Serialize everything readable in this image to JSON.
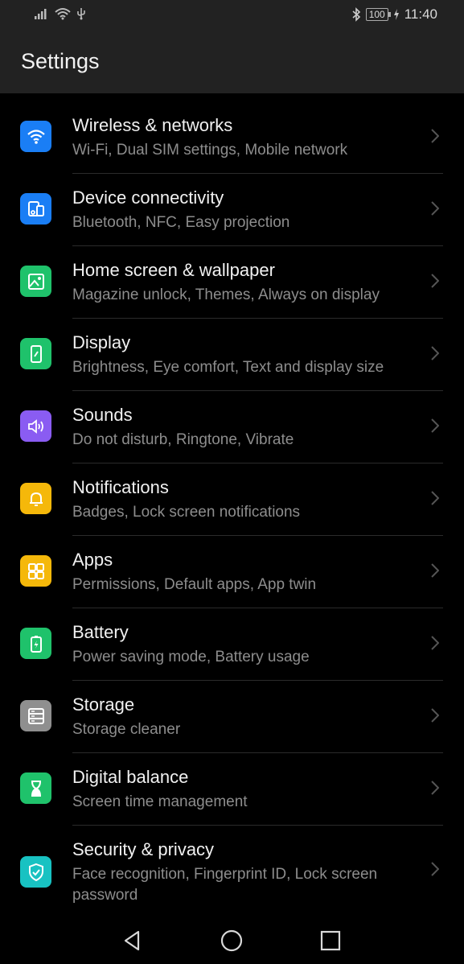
{
  "status": {
    "time": "11:40",
    "battery": "100",
    "icons": [
      "signal-icon",
      "wifi-icon",
      "usb-icon",
      "bluetooth-icon",
      "battery-icon",
      "charging-icon"
    ]
  },
  "header": {
    "title": "Settings"
  },
  "items": [
    {
      "title": "Wireless & networks",
      "subtitle": "Wi-Fi, Dual SIM settings, Mobile network",
      "icon": "wifi-icon",
      "color": "#1a7ef5"
    },
    {
      "title": "Device connectivity",
      "subtitle": "Bluetooth, NFC, Easy projection",
      "icon": "devices-icon",
      "color": "#1a7ef5"
    },
    {
      "title": "Home screen & wallpaper",
      "subtitle": "Magazine unlock, Themes, Always on display",
      "icon": "image-icon",
      "color": "#1fc26b"
    },
    {
      "title": "Display",
      "subtitle": "Brightness, Eye comfort, Text and display size",
      "icon": "display-icon",
      "color": "#1fc26b"
    },
    {
      "title": "Sounds",
      "subtitle": "Do not disturb, Ringtone, Vibrate",
      "icon": "speaker-icon",
      "color": "#8a5cf2"
    },
    {
      "title": "Notifications",
      "subtitle": "Badges, Lock screen notifications",
      "icon": "bell-icon",
      "color": "#f5b80a"
    },
    {
      "title": "Apps",
      "subtitle": "Permissions, Default apps, App twin",
      "icon": "apps-grid-icon",
      "color": "#f5b80a"
    },
    {
      "title": "Battery",
      "subtitle": "Power saving mode, Battery usage",
      "icon": "battery-icon",
      "color": "#1fc26b"
    },
    {
      "title": "Storage",
      "subtitle": "Storage cleaner",
      "icon": "storage-icon",
      "color": "#8f8f8f"
    },
    {
      "title": "Digital balance",
      "subtitle": "Screen time management",
      "icon": "hourglass-icon",
      "color": "#1fc26b"
    },
    {
      "title": "Security & privacy",
      "subtitle": "Face recognition, Fingerprint ID, Lock screen password",
      "icon": "shield-icon",
      "color": "#18c2c2"
    }
  ],
  "navbar": {
    "buttons": [
      "back-icon",
      "home-icon",
      "recents-icon"
    ]
  }
}
